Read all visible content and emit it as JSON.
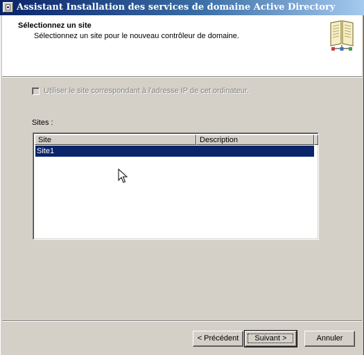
{
  "window": {
    "title": "Assistant Installation des services de domaine Active Directory",
    "icon": "ad-wizard-icon"
  },
  "header": {
    "title": "Sélectionnez un site",
    "subtitle": "Sélectionnez un site pour le nouveau contrôleur de domaine.",
    "icon": "directory-book-icon"
  },
  "checkbox": {
    "label": "Utiliser le site correspondant à l'adresse IP de cet ordinateur.",
    "checked": false,
    "enabled": false
  },
  "sites": {
    "label": "Sites :",
    "columns": [
      "Site",
      "Description"
    ],
    "rows": [
      {
        "site": "Site1",
        "description": "",
        "selected": true
      }
    ]
  },
  "buttons": {
    "previous": "< Précédent",
    "next": "Suivant >",
    "cancel": "Annuler"
  },
  "colors": {
    "selection": "#0a246a",
    "face": "#d4d0c8"
  }
}
